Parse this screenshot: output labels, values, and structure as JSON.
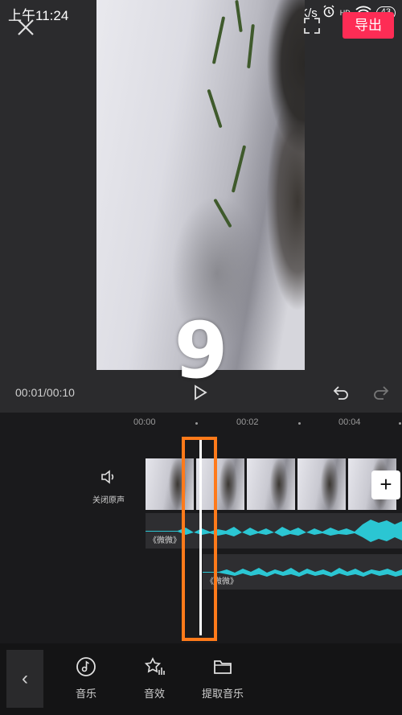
{
  "status_bar": {
    "time": "上午11:24",
    "speed": "0.0K/s",
    "hd": "HD",
    "battery": "43"
  },
  "header": {
    "export_label": "导出"
  },
  "preview": {
    "countdown_number": "9"
  },
  "playback": {
    "timecode": "00:01/00:10"
  },
  "timeline": {
    "ruler_labels": [
      "00:00",
      "00:02",
      "00:04"
    ],
    "mute_label": "关闭原声",
    "add_clip_label": "+",
    "audio_tracks": [
      {
        "label": "《微微》"
      },
      {
        "label": "《微微》"
      }
    ]
  },
  "bottom_toolbar": {
    "back_label": "‹",
    "items": [
      {
        "label": "音乐",
        "icon": "music-icon"
      },
      {
        "label": "音效",
        "icon": "sound-effect-icon"
      },
      {
        "label": "提取音乐",
        "icon": "folder-icon"
      }
    ]
  },
  "colors": {
    "accent": "#fe2c55",
    "waveform": "#2bc6d3",
    "highlight": "#ff7a1a"
  }
}
